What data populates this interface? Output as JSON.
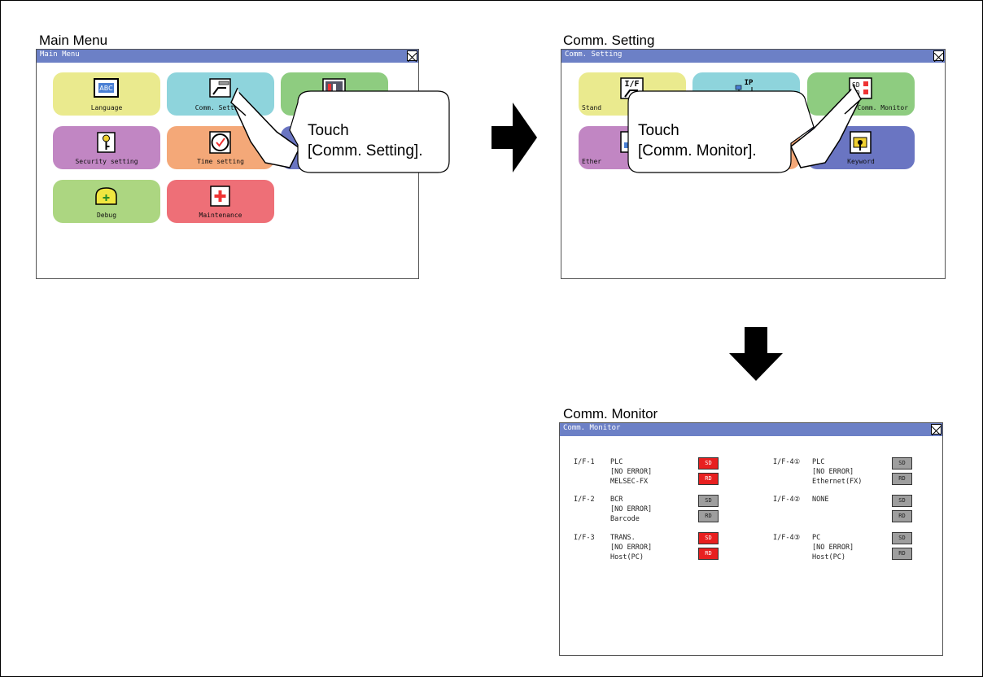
{
  "main_menu": {
    "caption": "Main Menu",
    "title": "Main Menu",
    "tiles": [
      {
        "label": "Language",
        "icon": "language-icon"
      },
      {
        "label": "Comm. Setting",
        "icon": "comm-setting-icon"
      },
      {
        "label": "",
        "icon": "display-setting-icon"
      },
      {
        "label": "Security setting",
        "icon": "security-key-icon"
      },
      {
        "label": "Time setting",
        "icon": "clock-icon"
      },
      {
        "label": "",
        "icon": "hidden-tile-icon"
      },
      {
        "label": "Debug",
        "icon": "debug-icon"
      },
      {
        "label": "Maintenance",
        "icon": "maintenance-icon"
      }
    ],
    "callout": {
      "line1": "Touch",
      "line2": "[Comm. Setting]."
    }
  },
  "comm_setting": {
    "caption": "Comm. Setting",
    "title": "Comm. Setting",
    "tiles": [
      {
        "label": "Stand",
        "icon": "standard-if-icon"
      },
      {
        "label": "",
        "icon": "ip-address-icon"
      },
      {
        "label": "Comm. Monitor",
        "icon": "sd-rd-monitor-icon"
      },
      {
        "label": "Ether",
        "icon": "ethernet-icon"
      },
      {
        "label": "",
        "icon": "hidden-tile-icon"
      },
      {
        "label": "Keyword",
        "icon": "keyword-icon"
      }
    ],
    "callout": {
      "line1": "Touch",
      "line2": "[Comm. Monitor]."
    }
  },
  "comm_monitor": {
    "caption": "Comm. Monitor",
    "title": "Comm. Monitor",
    "interfaces": [
      {
        "id": "I/F-1",
        "line1": "PLC",
        "line2": "[NO ERROR]",
        "line3": "MELSEC-FX",
        "sd": "SD",
        "rd": "RD",
        "sd_state": "on",
        "rd_state": "on"
      },
      {
        "id": "I/F-2",
        "line1": "BCR",
        "line2": "[NO ERROR]",
        "line3": "Barcode",
        "sd": "SD",
        "rd": "RD",
        "sd_state": "off",
        "rd_state": "off"
      },
      {
        "id": "I/F-3",
        "line1": "TRANS.",
        "line2": "[NO ERROR]",
        "line3": "Host(PC)",
        "sd": "SD",
        "rd": "RD",
        "sd_state": "on",
        "rd_state": "on"
      },
      {
        "id": "I/F-4①",
        "line1": "PLC",
        "line2": "[NO ERROR]",
        "line3": "Ethernet(FX)",
        "sd": "SD",
        "rd": "RD",
        "sd_state": "off",
        "rd_state": "off"
      },
      {
        "id": "I/F-4②",
        "line1": "NONE",
        "line2": "",
        "line3": "",
        "sd": "SD",
        "rd": "RD",
        "sd_state": "off",
        "rd_state": "off"
      },
      {
        "id": "I/F-4③",
        "line1": "PC",
        "line2": "[NO ERROR]",
        "line3": "Host(PC)",
        "sd": "SD",
        "rd": "RD",
        "sd_state": "off",
        "rd_state": "off"
      }
    ]
  },
  "colors": {
    "title_bar": "#6c80c6",
    "led_on": "#e82020",
    "led_off": "#9e9e9e"
  }
}
